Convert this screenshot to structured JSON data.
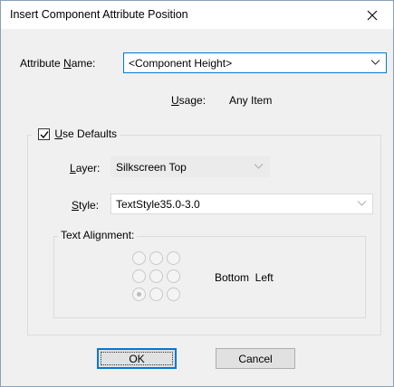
{
  "window": {
    "title": "Insert Component Attribute Position",
    "close_glyph": "close-icon"
  },
  "attribute_name": {
    "label_pre": "Attribute ",
    "label_accel": "N",
    "label_post": "ame:",
    "value": "<Component Height>"
  },
  "usage": {
    "label_accel": "U",
    "label_post": "sage:",
    "value": "Any Item"
  },
  "use_defaults": {
    "label_accel": "U",
    "label_post": "se Defaults",
    "checked": true
  },
  "layer": {
    "label_accel": "L",
    "label_post": "ayer:",
    "value": "Silkscreen Top"
  },
  "style": {
    "label_accel": "S",
    "label_post": "tyle:",
    "value": "TextStyle35.0-3.0"
  },
  "text_alignment": {
    "title": "Text Alignment:",
    "selected": "Bottom  Left",
    "selected_row": 2,
    "selected_col": 0
  },
  "buttons": {
    "ok": "OK",
    "cancel": "Cancel"
  },
  "colors": {
    "accent": "#0078d7",
    "dialog_bg": "#f0f0f0",
    "disabled_bg": "#ebebeb"
  }
}
